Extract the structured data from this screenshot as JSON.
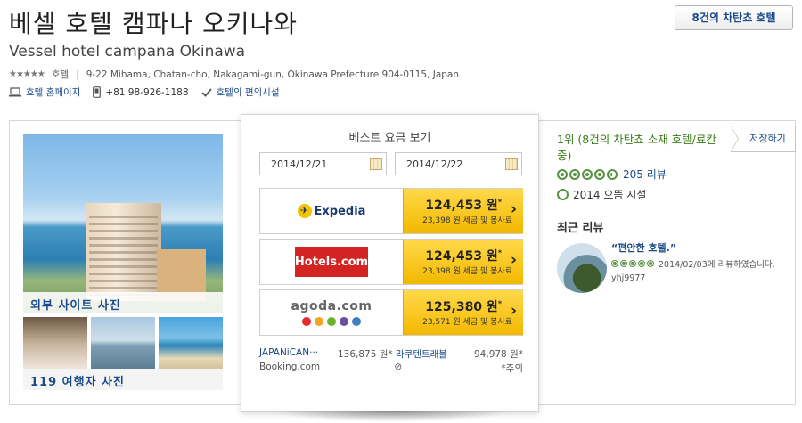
{
  "header": {
    "title": "베셀 호텔 캠파나 오키나와",
    "subtitle": "Vessel hotel campana Okinawa",
    "stars": "★★★★★",
    "category": "호텔",
    "address": "9-22 Mihama, Chatan-cho, Nakagami-gun, Okinawa Prefecture 904-0115, Japan",
    "deals_button": "8건의 차탄쵸 호텔"
  },
  "links": {
    "homepage": "호텔 홈페이지",
    "phone": "+81 98-926-1188",
    "amenities": "호텔의 편의시설"
  },
  "photos": {
    "main_caption": "외부 사이트 사진",
    "traveler_caption": "119 여행자 사진"
  },
  "prices": {
    "title": "베스트 요금 보기",
    "checkin": "2014/12/21",
    "checkout": "2014/12/22",
    "offers": [
      {
        "provider": "Expedia",
        "price": "124,453 원",
        "price_mark": "*",
        "tax": "23,398 원 세금 및 봉사료"
      },
      {
        "provider": "Hotels.com",
        "price": "124,453 원",
        "price_mark": "*",
        "tax": "23,398 원 세금 및 봉사료"
      },
      {
        "provider": "agoda.com",
        "price": "125,380 원",
        "price_mark": "*",
        "tax": "23,571 원 세금 및 봉사료"
      }
    ],
    "agoda_colors": [
      "#e8292f",
      "#f5a623",
      "#6ab42d",
      "#6b4fa0",
      "#3b7fc4"
    ],
    "small_offers": [
      {
        "name": "JAPANiCAN···",
        "price": "136,875 원*",
        "name2": "라쿠텐트래블",
        "price2": "94,978 원*"
      },
      {
        "name": "Booking.com",
        "price": "⊘",
        "name2": "",
        "price2": "*주의"
      }
    ]
  },
  "sidebar": {
    "rank": "1위 (8건의 차탄쵸 소재 호텔/료칸 중)",
    "save_button": "저장하기",
    "rating": 4.5,
    "reviews": "205 리뷰",
    "award": "2014 으뜸 시설",
    "recent_title": "최근 리뷰",
    "review_quote": "“편안한 호텔.”",
    "review_date": "2014/02/03에 리뷰하였습니다.",
    "review_user": "yhj9977"
  },
  "colors": {
    "link": "#1a4a8a",
    "rank_green": "#3a7d1a",
    "cta_yellow": "#f3b800",
    "hotels_red": "#d32323"
  }
}
